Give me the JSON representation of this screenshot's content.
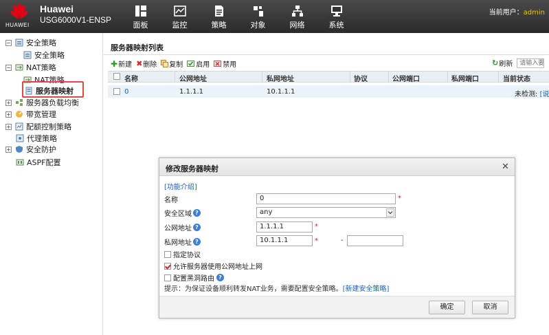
{
  "header": {
    "brand_name": "Huawei",
    "brand_model": "USG6000V1-ENSP",
    "logo_text": "HUAWEI",
    "current_user_label": "当前用户：",
    "current_user": "admin",
    "nav": [
      {
        "label": "面板",
        "icon": "dashboard-icon"
      },
      {
        "label": "监控",
        "icon": "monitor-icon"
      },
      {
        "label": "策略",
        "icon": "policy-icon"
      },
      {
        "label": "对象",
        "icon": "object-icon"
      },
      {
        "label": "网络",
        "icon": "network-icon"
      },
      {
        "label": "系统",
        "icon": "system-icon"
      }
    ],
    "active_nav": "策略"
  },
  "sidebar": {
    "items": [
      {
        "label": "安全策略",
        "level": 0,
        "toggle": "−",
        "icon": "security-policy-icon"
      },
      {
        "label": "安全策略",
        "level": 1,
        "icon": "security-policy-icon"
      },
      {
        "label": "NAT策略",
        "level": 0,
        "toggle": "−",
        "icon": "nat-icon"
      },
      {
        "label": "NAT策略",
        "level": 1,
        "icon": "nat-icon"
      },
      {
        "label": "服务器映射",
        "level": 1,
        "icon": "server-mapping-icon",
        "selected": true
      },
      {
        "label": "服务器负载均衡",
        "level": 0,
        "toggle": "+",
        "icon": "load-balance-icon"
      },
      {
        "label": "带宽管理",
        "level": 0,
        "toggle": "+",
        "icon": "bandwidth-icon"
      },
      {
        "label": "配额控制策略",
        "level": 0,
        "toggle": "+",
        "icon": "quota-icon"
      },
      {
        "label": "代理策略",
        "level": 0,
        "icon": "proxy-icon"
      },
      {
        "label": "安全防护",
        "level": 0,
        "toggle": "+",
        "icon": "shield-icon"
      },
      {
        "label": "ASPF配置",
        "level": 0,
        "icon": "aspf-icon"
      }
    ]
  },
  "main": {
    "title": "服务器映射列表",
    "toolbar": {
      "new": "新建",
      "delete": "删除",
      "copy": "复制",
      "enable": "启用",
      "disable": "禁用",
      "refresh": "刷新",
      "search_placeholder": "请输入要"
    },
    "table": {
      "columns": [
        "名称",
        "公网地址",
        "私网地址",
        "协议",
        "公网端口",
        "私网端口",
        "当前状态"
      ],
      "rows": [
        {
          "name": "0",
          "public_ip": "1.1.1.1",
          "private_ip": "10.1.1.1",
          "protocol": "",
          "public_port": "",
          "private_port": "",
          "status": "未检测",
          "status_link": "[说"
        }
      ]
    }
  },
  "dialog": {
    "title": "修改服务器映射",
    "func_link": "[功能介绍]",
    "fields": {
      "name_label": "名称",
      "name_value": "0",
      "zone_label": "安全区域",
      "zone_value": "any",
      "public_label": "公网地址",
      "public_value": "1.1.1.1",
      "private_label": "私网地址",
      "private_value": "10.1.1.1",
      "port_dash": "-"
    },
    "checkboxes": [
      {
        "label": "指定协议",
        "checked": false
      },
      {
        "label": "允许服务器使用公网地址上网",
        "checked": true
      },
      {
        "label": "配置黑洞路由",
        "checked": false
      }
    ],
    "tip_text": "提示：为保证设备顺利转发NAT业务，需要配置安全策略。",
    "tip_link": "[新建安全策略]",
    "ok_label": "确定",
    "cancel_label": "取消"
  },
  "colors": {
    "header_bg": "#333333",
    "accent_red": "#e04848",
    "link_blue": "#1d5fbf",
    "user_yellow": "#f2c200"
  }
}
